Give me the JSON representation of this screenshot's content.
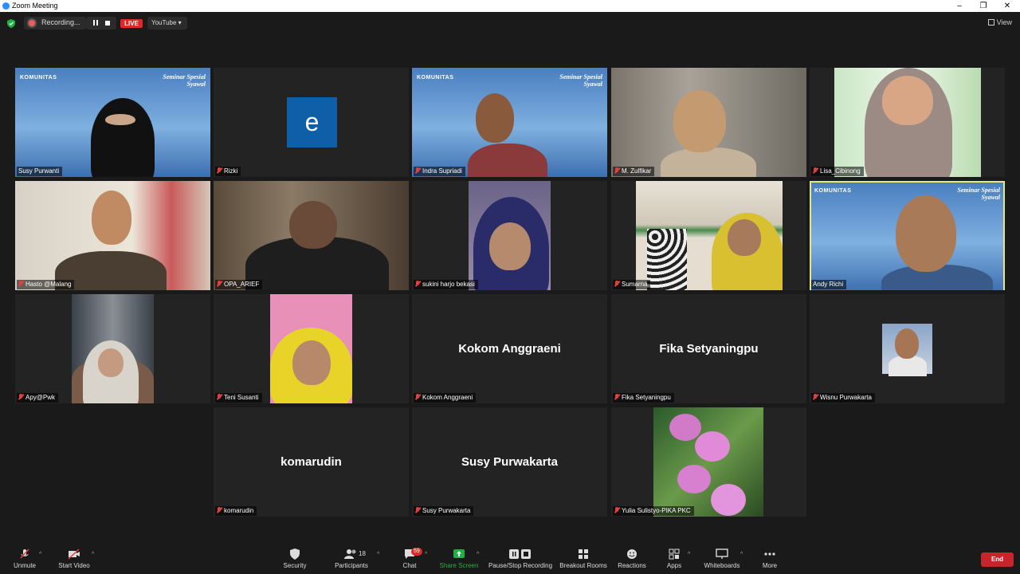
{
  "window": {
    "title": "Zoom Meeting"
  },
  "topbar": {
    "recording_label": "Recording...",
    "live_label": "LIVE",
    "stream_label": "YouTube",
    "view_label": "View"
  },
  "participants": [
    {
      "name": "Susy Purwanti"
    },
    {
      "name": "Rizki",
      "avatar_letter": "e"
    },
    {
      "name": "Indra Supriadi"
    },
    {
      "name": "M. Zulfikar"
    },
    {
      "name": "Lisa_Cibinong"
    },
    {
      "name": "Hasto @Malang"
    },
    {
      "name": "OPA_ARIEF"
    },
    {
      "name": "sukini harjo bekasi"
    },
    {
      "name": "Sumarna"
    },
    {
      "name": "Andy Richi"
    },
    {
      "name": "Apy@Pwk"
    },
    {
      "name": "Teni Susanti"
    },
    {
      "name": "Kokom Anggraeni",
      "display": "Kokom Anggraeni"
    },
    {
      "name": "Fika Setyaningpu",
      "display": "Fika Setyaningpu"
    },
    {
      "name": "Wisnu Purwakarta"
    },
    {
      "name": "komarudin",
      "display": "komarudin"
    },
    {
      "name": "Susy Purwakarta",
      "display": "Susy Purwakarta"
    },
    {
      "name": "Yulia Sulistyo-PIKA PKC"
    }
  ],
  "banner": {
    "logo_text": "KOMUNITAS",
    "logo_sub": "KELUARGA SURGA",
    "title_line1": "Seminar Spesial",
    "title_line2": "Syawal"
  },
  "toolbar": {
    "unmute": "Unmute",
    "start_video": "Start Video",
    "security": "Security",
    "participants": "Participants",
    "participants_count": "18",
    "chat": "Chat",
    "chat_badge": "59",
    "share_screen": "Share Screen",
    "pause_stop_recording": "Pause/Stop Recording",
    "breakout_rooms": "Breakout Rooms",
    "reactions": "Reactions",
    "apps": "Apps",
    "whiteboards": "Whiteboards",
    "more": "More",
    "end": "End"
  },
  "colors": {
    "accent": "#2d8cff",
    "live": "#e02828",
    "share": "#1fb141",
    "end": "#c7252b",
    "active_border": "#e5e58a"
  }
}
